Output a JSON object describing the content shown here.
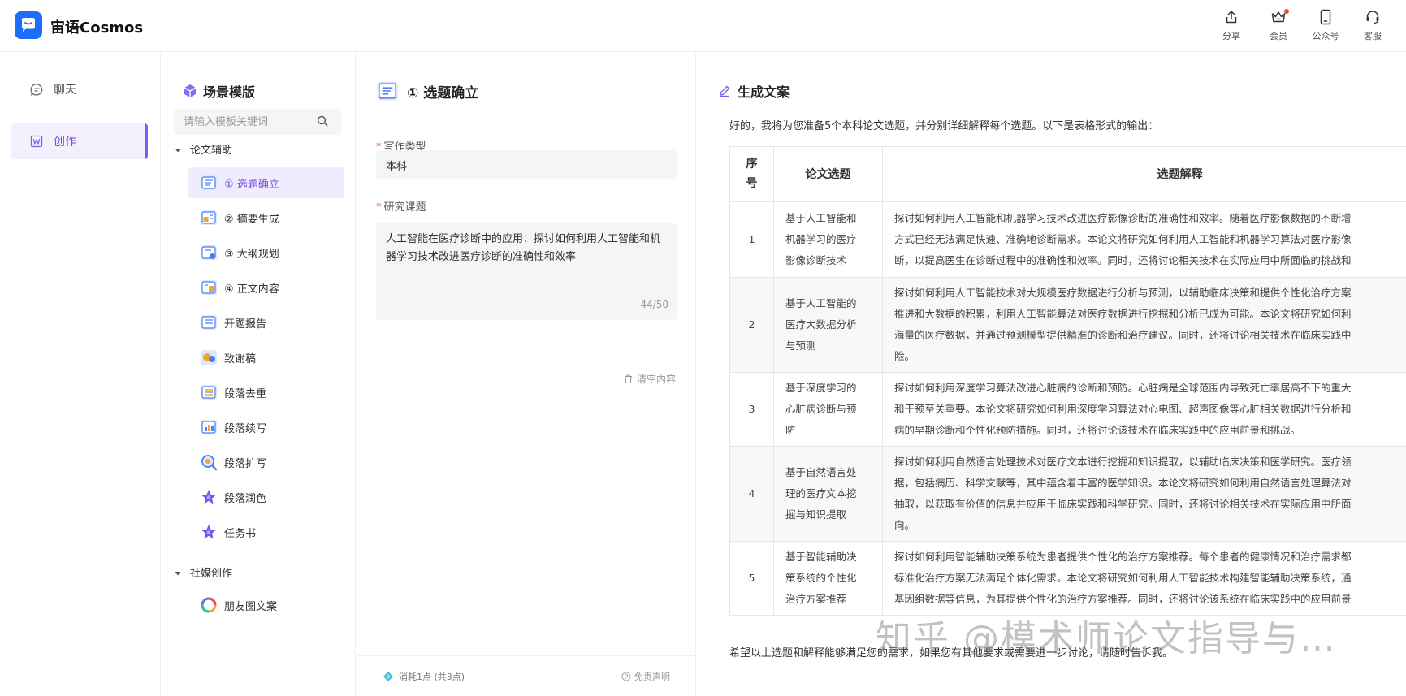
{
  "app": {
    "title": "宙语Cosmos"
  },
  "header": {
    "actions": [
      {
        "label": "分享",
        "icon": "share-icon"
      },
      {
        "label": "会员",
        "icon": "crown-icon"
      },
      {
        "label": "公众号",
        "icon": "phone-icon"
      },
      {
        "label": "客服",
        "icon": "headset-icon"
      }
    ]
  },
  "leftnav": {
    "items": [
      {
        "label": "聊天",
        "icon": "chat-icon",
        "active": false
      },
      {
        "label": "创作",
        "icon": "word-doc-icon",
        "active": true
      }
    ]
  },
  "templates": {
    "heading": "场景模版",
    "search_placeholder": "请输入模板关键词",
    "groups": [
      {
        "label": "论文辅助",
        "items": [
          {
            "label": "① 选题确立",
            "active": true
          },
          {
            "label": "② 摘要生成"
          },
          {
            "label": "③ 大纲规划"
          },
          {
            "label": "④ 正文内容"
          },
          {
            "label": "开题报告"
          },
          {
            "label": "致谢稿"
          },
          {
            "label": "段落去重"
          },
          {
            "label": "段落续写"
          },
          {
            "label": "段落扩写"
          },
          {
            "label": "段落润色"
          },
          {
            "label": "任务书"
          }
        ]
      },
      {
        "label": "社媒创作",
        "items": [
          {
            "label": "朋友圈文案"
          }
        ]
      }
    ]
  },
  "form": {
    "title": "① 选题确立",
    "fields": {
      "writing_type": {
        "label": "写作类型",
        "value": "本科"
      },
      "research_topic": {
        "label": "研究课题",
        "value": "人工智能在医疗诊断中的应用：探讨如何利用人工智能和机器学习技术改进医疗诊断的准确性和效率",
        "count": "44/50"
      }
    },
    "clear_label": "清空内容",
    "footer": {
      "cost": "消耗1点 (共3点)",
      "disclaimer": "免责声明"
    }
  },
  "output": {
    "title": "生成文案",
    "intro": "好的，我将为您准备5个本科论文选题，并分别详细解释每个选题。以下是表格形式的输出：",
    "table": {
      "headers": [
        "序号",
        "论文选题",
        "选题解释"
      ],
      "rows": [
        {
          "num": "1",
          "topic": [
            "基于人工智能和",
            "机器学习的医疗",
            "影像诊断技术"
          ],
          "explanation": [
            "探讨如何利用人工智能和机器学习技术改进医疗影像诊断的准确性和效率。随着医疗影像数据的不断增",
            "方式已经无法满足快速、准确地诊断需求。本论文将研究如何利用人工智能和机器学习算法对医疗影像",
            "断，以提高医生在诊断过程中的准确性和效率。同时，还将讨论相关技术在实际应用中所面临的挑战和"
          ]
        },
        {
          "num": "2",
          "topic": [
            "基于人工智能的",
            "医疗大数据分析",
            "与预测"
          ],
          "explanation": [
            "探讨如何利用人工智能技术对大规模医疗数据进行分析与预测，以辅助临床决策和提供个性化治疗方案",
            "推进和大数据的积累，利用人工智能算法对医疗数据进行挖掘和分析已成为可能。本论文将研究如何利",
            "海量的医疗数据，并通过预测模型提供精准的诊断和治疗建议。同时，还将讨论相关技术在临床实践中",
            "险。"
          ]
        },
        {
          "num": "3",
          "topic": [
            "基于深度学习的",
            "心脏病诊断与预",
            "防"
          ],
          "explanation": [
            "探讨如何利用深度学习算法改进心脏病的诊断和预防。心脏病是全球范围内导致死亡率居高不下的重大",
            "和干预至关重要。本论文将研究如何利用深度学习算法对心电图、超声图像等心脏相关数据进行分析和",
            "病的早期诊断和个性化预防措施。同时，还将讨论该技术在临床实践中的应用前景和挑战。"
          ]
        },
        {
          "num": "4",
          "topic": [
            "基于自然语言处",
            "理的医疗文本挖",
            "掘与知识提取"
          ],
          "explanation": [
            "探讨如何利用自然语言处理技术对医疗文本进行挖掘和知识提取，以辅助临床决策和医学研究。医疗领",
            "据，包括病历、科学文献等，其中蕴含着丰富的医学知识。本论文将研究如何利用自然语言处理算法对",
            "抽取，以获取有价值的信息并应用于临床实践和科学研究。同时，还将讨论相关技术在实际应用中所面",
            "向。"
          ]
        },
        {
          "num": "5",
          "topic": [
            "基于智能辅助决",
            "策系统的个性化",
            "治疗方案推荐"
          ],
          "explanation": [
            "探讨如何利用智能辅助决策系统为患者提供个性化的治疗方案推荐。每个患者的健康情况和治疗需求都",
            "标准化治疗方案无法满足个体化需求。本论文将研究如何利用人工智能技术构建智能辅助决策系统，通",
            "基因组数据等信息，为其提供个性化的治疗方案推荐。同时，还将讨论该系统在临床实践中的应用前景"
          ]
        }
      ]
    },
    "closing": "希望以上选题和解释能够满足您的需求，如果您有其他要求或需要进一步讨论，请随时告诉我。"
  },
  "watermark": "知乎 @模术师论文指导与…",
  "colors": {
    "accent": "#7b5cf0",
    "brand": "#1e6df6",
    "active_bg": "#f1ecfd"
  }
}
